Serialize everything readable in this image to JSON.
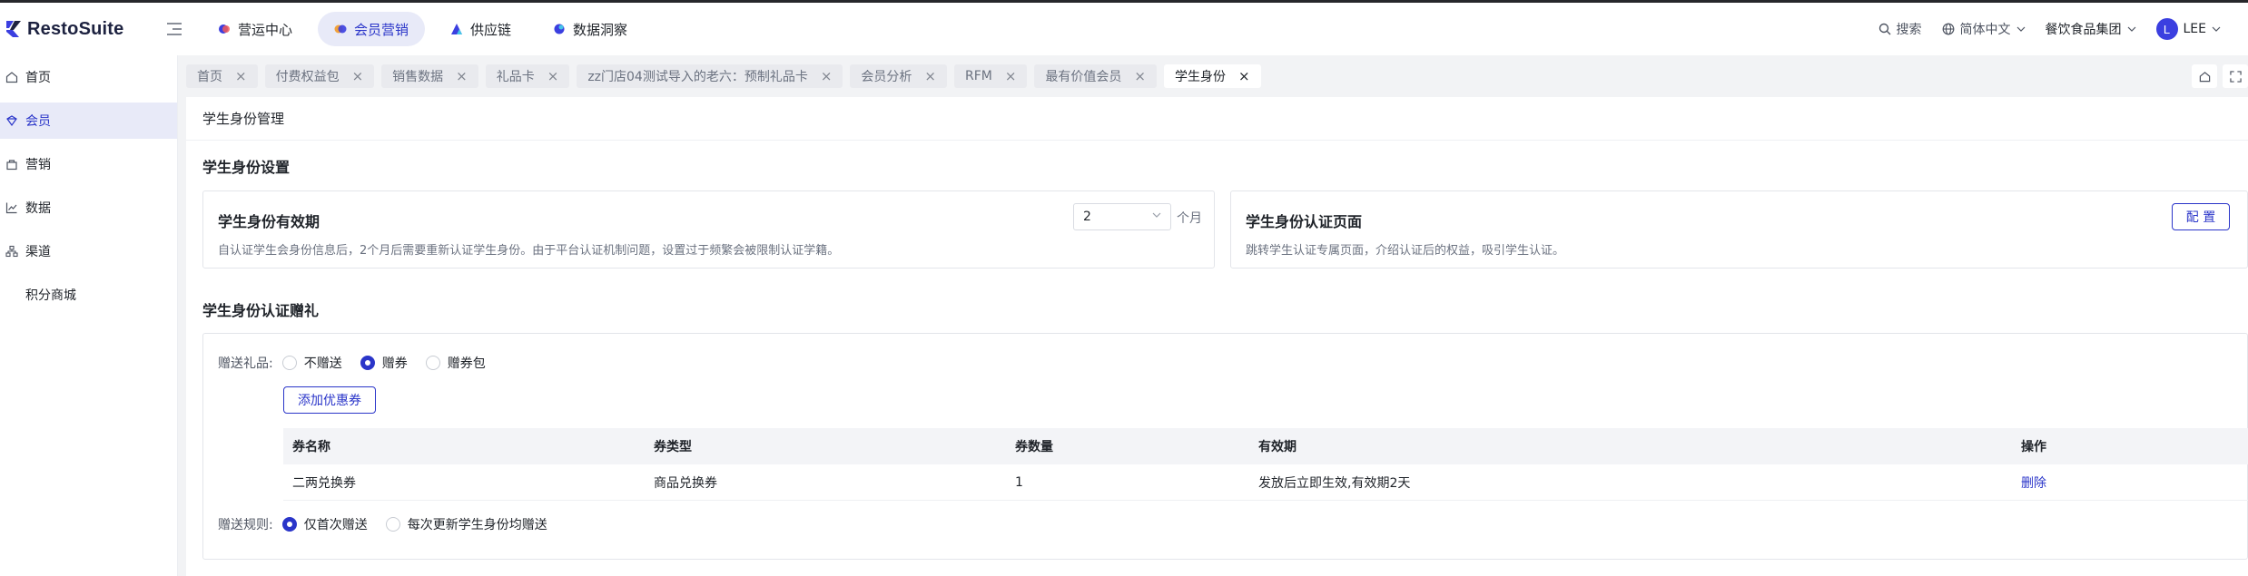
{
  "app": {
    "name": "RestoSuite"
  },
  "topnav": [
    {
      "label": "营运中心",
      "icon": "operations-icon",
      "active": false
    },
    {
      "label": "会员营销",
      "icon": "membership-icon",
      "active": true
    },
    {
      "label": "供应链",
      "icon": "supply-chain-icon",
      "active": false
    },
    {
      "label": "数据洞察",
      "icon": "data-insight-icon",
      "active": false
    }
  ],
  "header_right": {
    "search": "搜索",
    "language": "简体中文",
    "org": "餐饮食品集团",
    "avatar_letter": "L",
    "user": "LEE"
  },
  "sidebar": [
    {
      "label": "首页",
      "icon": "home-icon",
      "active": false
    },
    {
      "label": "会员",
      "icon": "member-icon",
      "active": true
    },
    {
      "label": "营销",
      "icon": "marketing-icon",
      "active": false
    },
    {
      "label": "数据",
      "icon": "chart-icon",
      "active": false
    },
    {
      "label": "渠道",
      "icon": "channel-icon",
      "active": false
    },
    {
      "label": "积分商城",
      "icon": "",
      "active": false
    }
  ],
  "tabs": [
    {
      "label": "首页",
      "active": false
    },
    {
      "label": "付费权益包",
      "active": false
    },
    {
      "label": "销售数据",
      "active": false
    },
    {
      "label": "礼品卡",
      "active": false
    },
    {
      "label": "zz门店04测试导入的老六：预制礼品卡",
      "active": false
    },
    {
      "label": "会员分析",
      "active": false
    },
    {
      "label": "RFM",
      "active": false
    },
    {
      "label": "最有价值会员",
      "active": false
    },
    {
      "label": "学生身份",
      "active": true
    }
  ],
  "page": {
    "title": "学生身份管理",
    "settings_section": "学生身份设置",
    "validity": {
      "title": "学生身份有效期",
      "desc": "自认证学生会身份信息后，2个月后需要重新认证学生身份。由于平台认证机制问题，设置过于频繁会被限制认证学籍。",
      "value": "2",
      "unit": "个月"
    },
    "auth_page": {
      "title": "学生身份认证页面",
      "desc": "跳转学生认证专属页面，介绍认证后的权益，吸引学生认证。",
      "button": "配 置"
    },
    "gift_section": "学生身份认证赠礼",
    "gift": {
      "label": "赠送礼品:",
      "options": [
        {
          "label": "不赠送",
          "checked": false
        },
        {
          "label": "赠券",
          "checked": true
        },
        {
          "label": "赠券包",
          "checked": false
        }
      ],
      "add_button": "添加优惠券",
      "table": {
        "headers": [
          "券名称",
          "券类型",
          "券数量",
          "有效期",
          "操作"
        ],
        "rows": [
          {
            "name": "二两兑换券",
            "type": "商品兑换券",
            "qty": "1",
            "validity": "发放后立即生效,有效期2天",
            "action": "删除"
          }
        ]
      },
      "rule_label": "赠送规则:",
      "rules": [
        {
          "label": "仅首次赠送",
          "checked": true
        },
        {
          "label": "每次更新学生身份均赠送",
          "checked": false
        }
      ]
    }
  },
  "colors": {
    "accent": "#2a35c9",
    "accent_bg": "#e8eaf8"
  }
}
